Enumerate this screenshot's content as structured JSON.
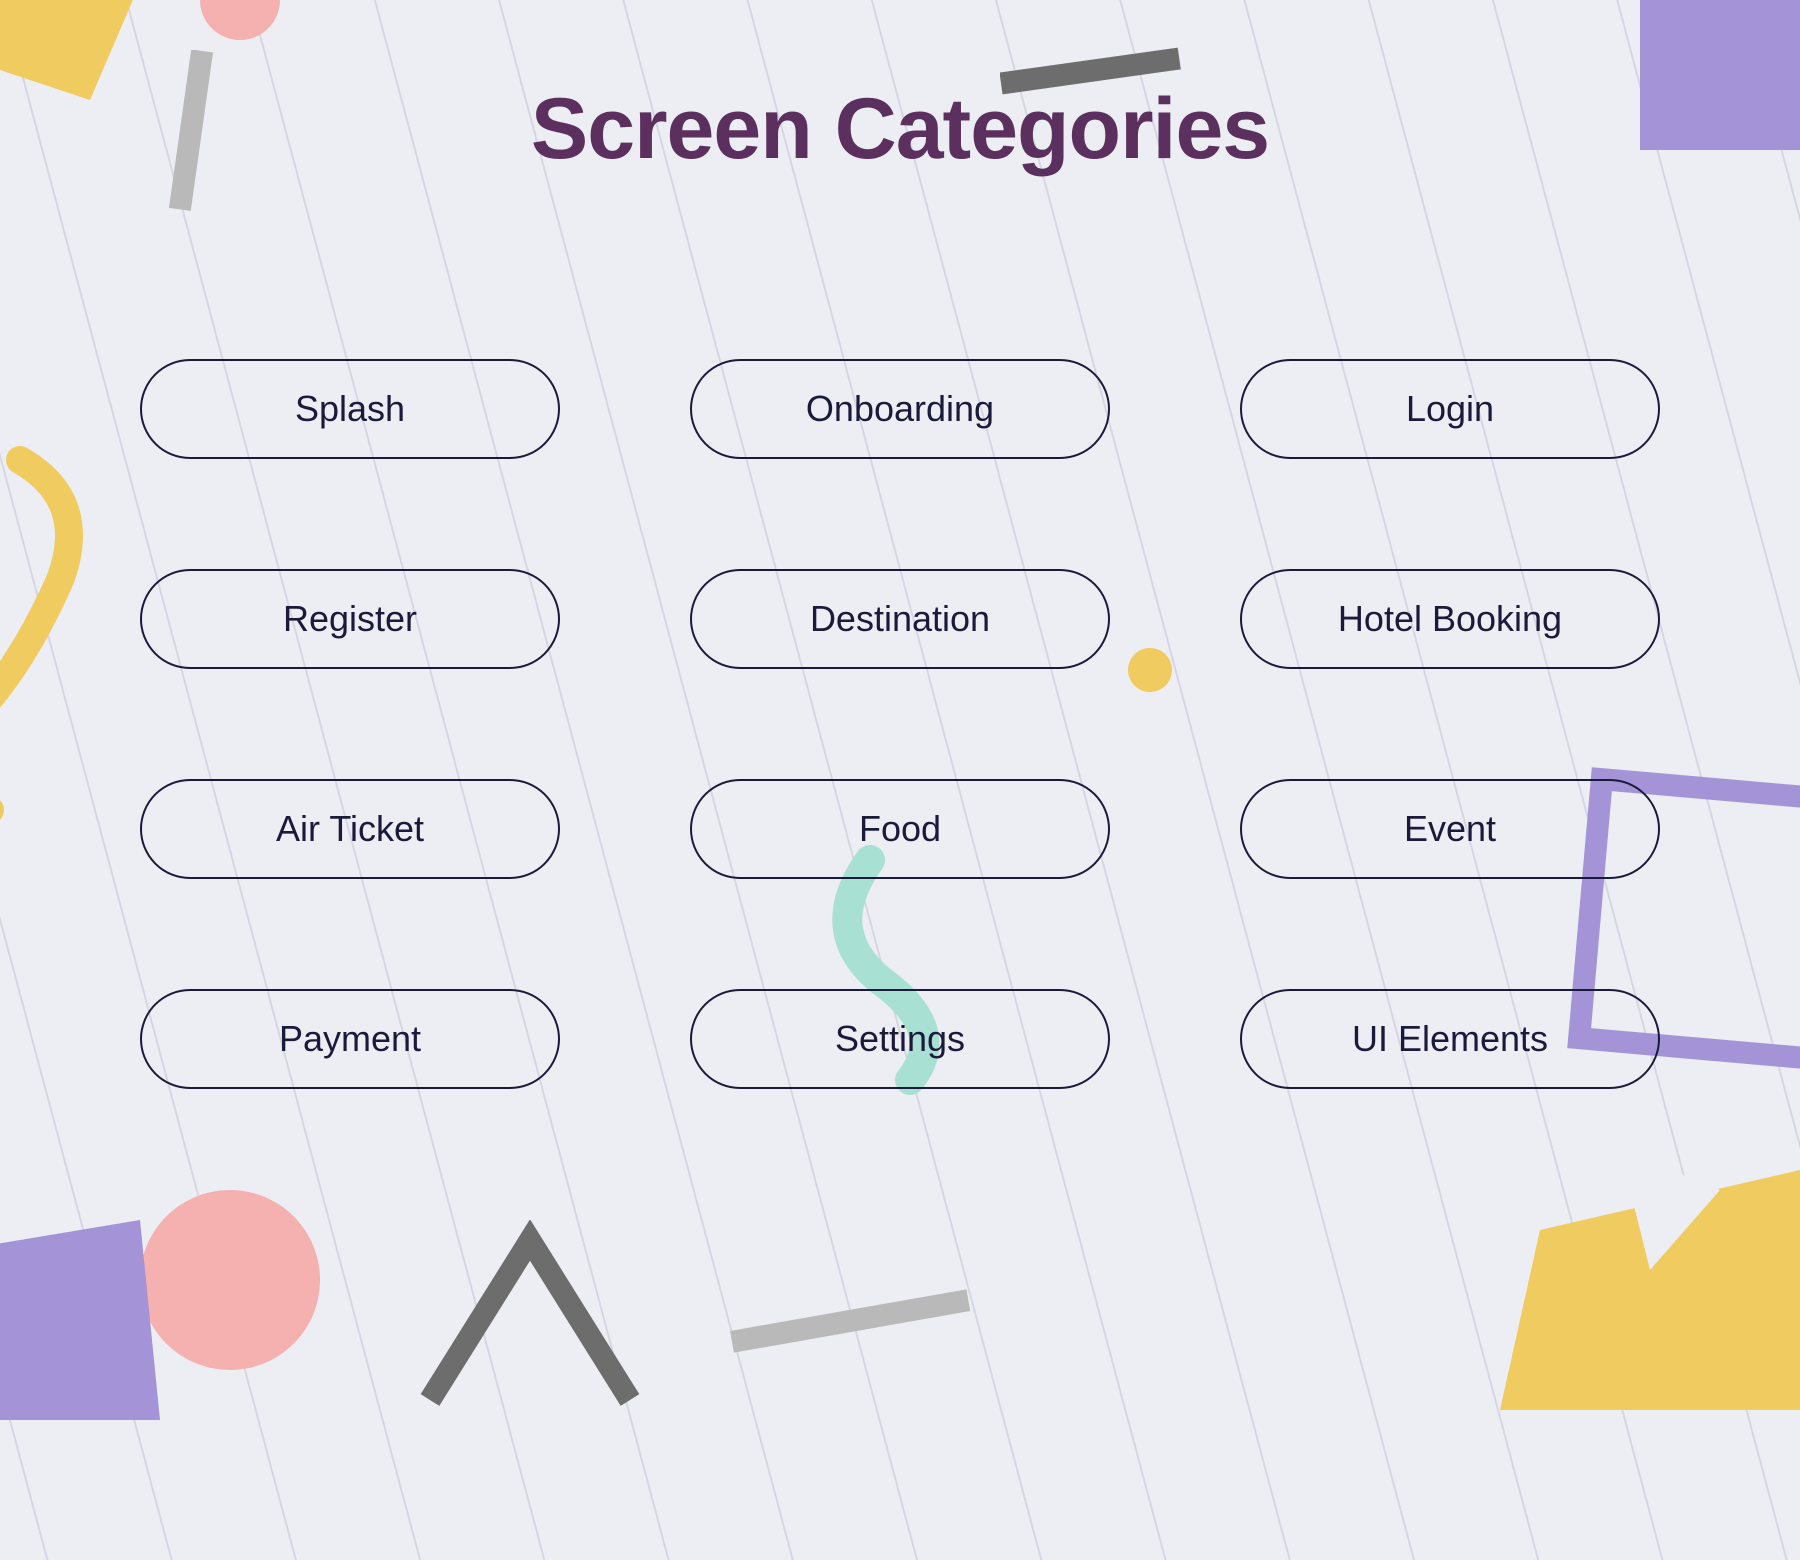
{
  "title": "Screen Categories",
  "categories": [
    {
      "label": "Splash",
      "name": "splash"
    },
    {
      "label": "Onboarding",
      "name": "onboarding"
    },
    {
      "label": "Login",
      "name": "login"
    },
    {
      "label": "Register",
      "name": "register"
    },
    {
      "label": "Destination",
      "name": "destination"
    },
    {
      "label": "Hotel Booking",
      "name": "hotel-booking"
    },
    {
      "label": "Air Ticket",
      "name": "air-ticket"
    },
    {
      "label": "Food",
      "name": "food"
    },
    {
      "label": "Event",
      "name": "event"
    },
    {
      "label": "Payment",
      "name": "payment"
    },
    {
      "label": "Settings",
      "name": "settings"
    },
    {
      "label": "UI Elements",
      "name": "ui-elements"
    }
  ],
  "colors": {
    "bg": "#EDEDF4",
    "title": "#5B305E",
    "pill_border": "#1A1B3A",
    "pill_text": "#1A1B3A",
    "yellow": "#F0CB5F",
    "purple": "#A493D6",
    "pink": "#F5B0B0",
    "mint": "#A8E0D4",
    "gray": "#6D6D6D",
    "light_gray": "#B9B9B9"
  }
}
